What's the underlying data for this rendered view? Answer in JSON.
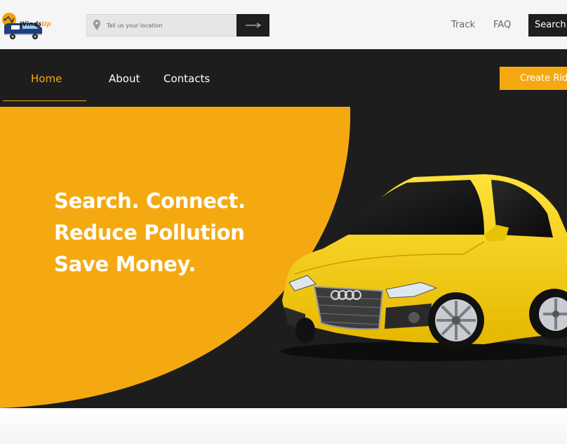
{
  "brand": {
    "name_part1": "Winds",
    "name_part2": "Up",
    "accent": "#f5a911"
  },
  "header": {
    "search": {
      "placeholder": "Tell us your location",
      "icon": "location-pin-icon",
      "submit_icon": "arrow-right-icon"
    },
    "links": {
      "track": "Track",
      "faq": "FAQ"
    },
    "search_button": "Search R"
  },
  "nav": {
    "items": [
      {
        "label": "Home",
        "active": true
      },
      {
        "label": "About",
        "active": false
      },
      {
        "label": "Contacts",
        "active": false
      }
    ],
    "create_ride": "Create Ride"
  },
  "hero": {
    "lines": [
      "Search. Connect.",
      "Reduce Pollution",
      "Save Money."
    ],
    "image": "yellow-sedan-car"
  },
  "colors": {
    "dark": "#1e1d1d",
    "orange": "#f5a911",
    "topbar": "#f5f5f5"
  }
}
